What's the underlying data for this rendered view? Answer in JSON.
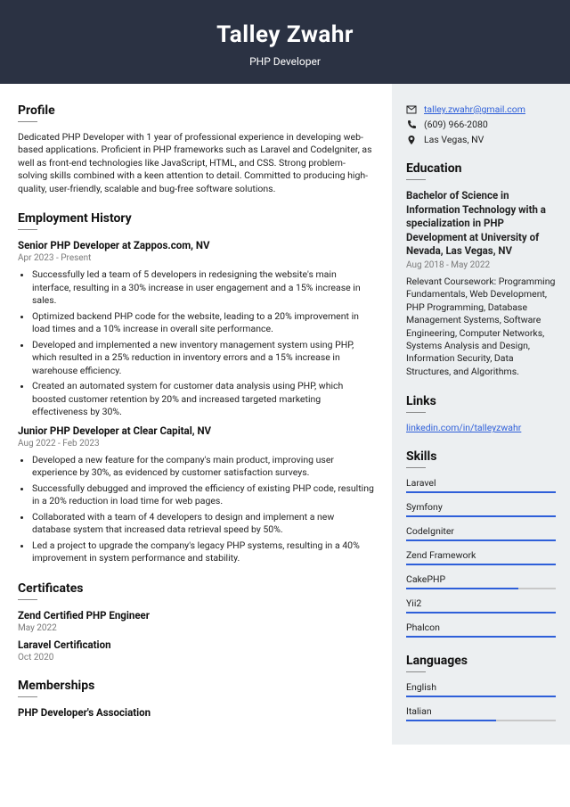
{
  "header": {
    "name": "Talley Zwahr",
    "title": "PHP Developer"
  },
  "profile": {
    "heading": "Profile",
    "text": "Dedicated PHP Developer with 1 year of professional experience in developing web-based applications. Proficient in PHP frameworks such as Laravel and CodeIgniter, as well as front-end technologies like JavaScript, HTML, and CSS. Strong problem-solving skills combined with a keen attention to detail. Committed to producing high-quality, user-friendly, scalable and bug-free software solutions."
  },
  "employment": {
    "heading": "Employment History",
    "jobs": [
      {
        "title": "Senior PHP Developer at Zappos.com, NV",
        "dates": "Apr 2023 - Present",
        "bullets": [
          "Successfully led a team of 5 developers in redesigning the website's main interface, resulting in a 30% increase in user engagement and a 15% increase in sales.",
          "Optimized backend PHP code for the website, leading to a 20% improvement in load times and a 10% increase in overall site performance.",
          "Developed and implemented a new inventory management system using PHP, which resulted in a 25% reduction in inventory errors and a 15% increase in warehouse efficiency.",
          "Created an automated system for customer data analysis using PHP, which boosted customer retention by 20% and increased targeted marketing effectiveness by 30%."
        ]
      },
      {
        "title": "Junior PHP Developer at Clear Capital, NV",
        "dates": "Aug 2022 - Feb 2023",
        "bullets": [
          "Developed a new feature for the company's main product, improving user experience by 30%, as evidenced by customer satisfaction surveys.",
          "Successfully debugged and improved the efficiency of existing PHP code, resulting in a 20% reduction in load time for web pages.",
          "Collaborated with a team of 4 developers to design and implement a new database system that increased data retrieval speed by 50%.",
          "Led a project to upgrade the company's legacy PHP systems, resulting in a 40% improvement in system performance and stability."
        ]
      }
    ]
  },
  "certificates": {
    "heading": "Certificates",
    "items": [
      {
        "title": "Zend Certified PHP Engineer",
        "date": "May 2022"
      },
      {
        "title": "Laravel Certification",
        "date": "Oct 2020"
      }
    ]
  },
  "memberships": {
    "heading": "Memberships",
    "items": [
      {
        "title": "PHP Developer's Association"
      }
    ]
  },
  "contact": {
    "email": "talley.zwahr@gmail.com",
    "phone": "(609) 966-2080",
    "location": "Las Vegas, NV"
  },
  "education": {
    "heading": "Education",
    "degree": "Bachelor of Science in Information Technology with a specialization in PHP Development at University of Nevada, Las Vegas, NV",
    "dates": "Aug 2018 - May 2022",
    "text": "Relevant Coursework: Programming Fundamentals, Web Development, PHP Programming, Database Management Systems, Software Engineering, Computer Networks, Systems Analysis and Design, Information Security, Data Structures, and Algorithms."
  },
  "links": {
    "heading": "Links",
    "items": [
      "linkedin.com/in/talleyzwahr"
    ]
  },
  "skills": {
    "heading": "Skills",
    "items": [
      {
        "name": "Laravel",
        "level": 100
      },
      {
        "name": "Symfony",
        "level": 100
      },
      {
        "name": "CodeIgniter",
        "level": 100
      },
      {
        "name": "Zend Framework",
        "level": 100
      },
      {
        "name": "CakePHP",
        "level": 75
      },
      {
        "name": "Yii2",
        "level": 100
      },
      {
        "name": "Phalcon",
        "level": 100
      }
    ]
  },
  "languages": {
    "heading": "Languages",
    "items": [
      {
        "name": "English",
        "level": 100
      },
      {
        "name": "Italian",
        "level": 60
      }
    ]
  }
}
